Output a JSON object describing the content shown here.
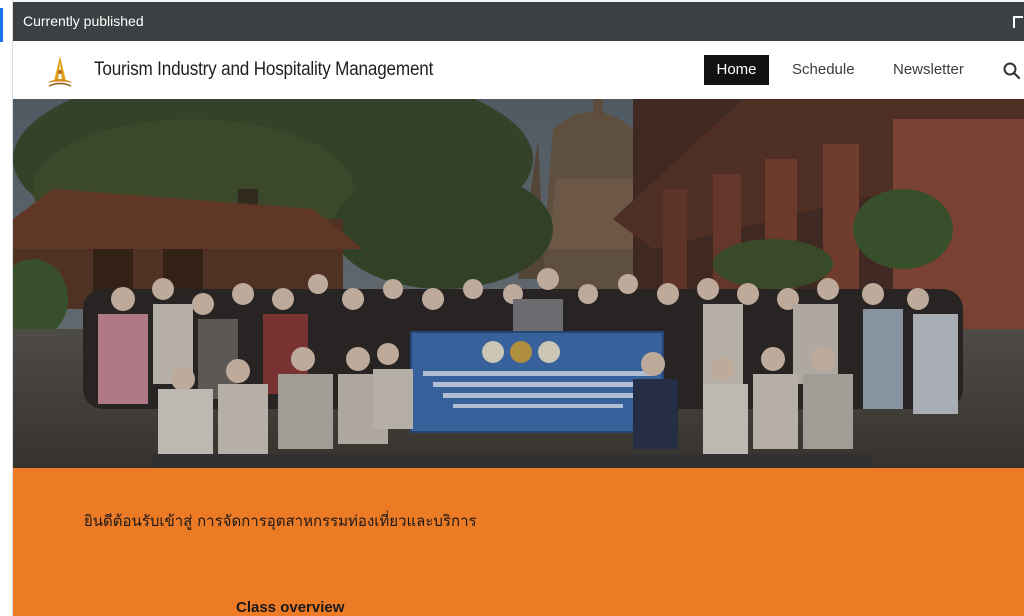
{
  "editor": {
    "published_label": "Currently published",
    "expand_icon": "expand-icon"
  },
  "site": {
    "title": "Tourism Industry and Hospitality Management",
    "nav": {
      "home": "Home",
      "schedule": "Schedule",
      "newsletter": "Newsletter",
      "search_icon": "search-icon"
    },
    "hero": {
      "description_icon": "group-photo-image"
    },
    "welcome": "ยินดีต้อนรับเข้าสู่ การจัดการอุตสาหกรรมท่องเที่ยวและบริการ",
    "class_overview": "Class overview"
  },
  "colors": {
    "accent": "#1a73e8",
    "publish_bar": "#3c4043",
    "nav_active": "#121212",
    "band": "#ed7a24"
  }
}
